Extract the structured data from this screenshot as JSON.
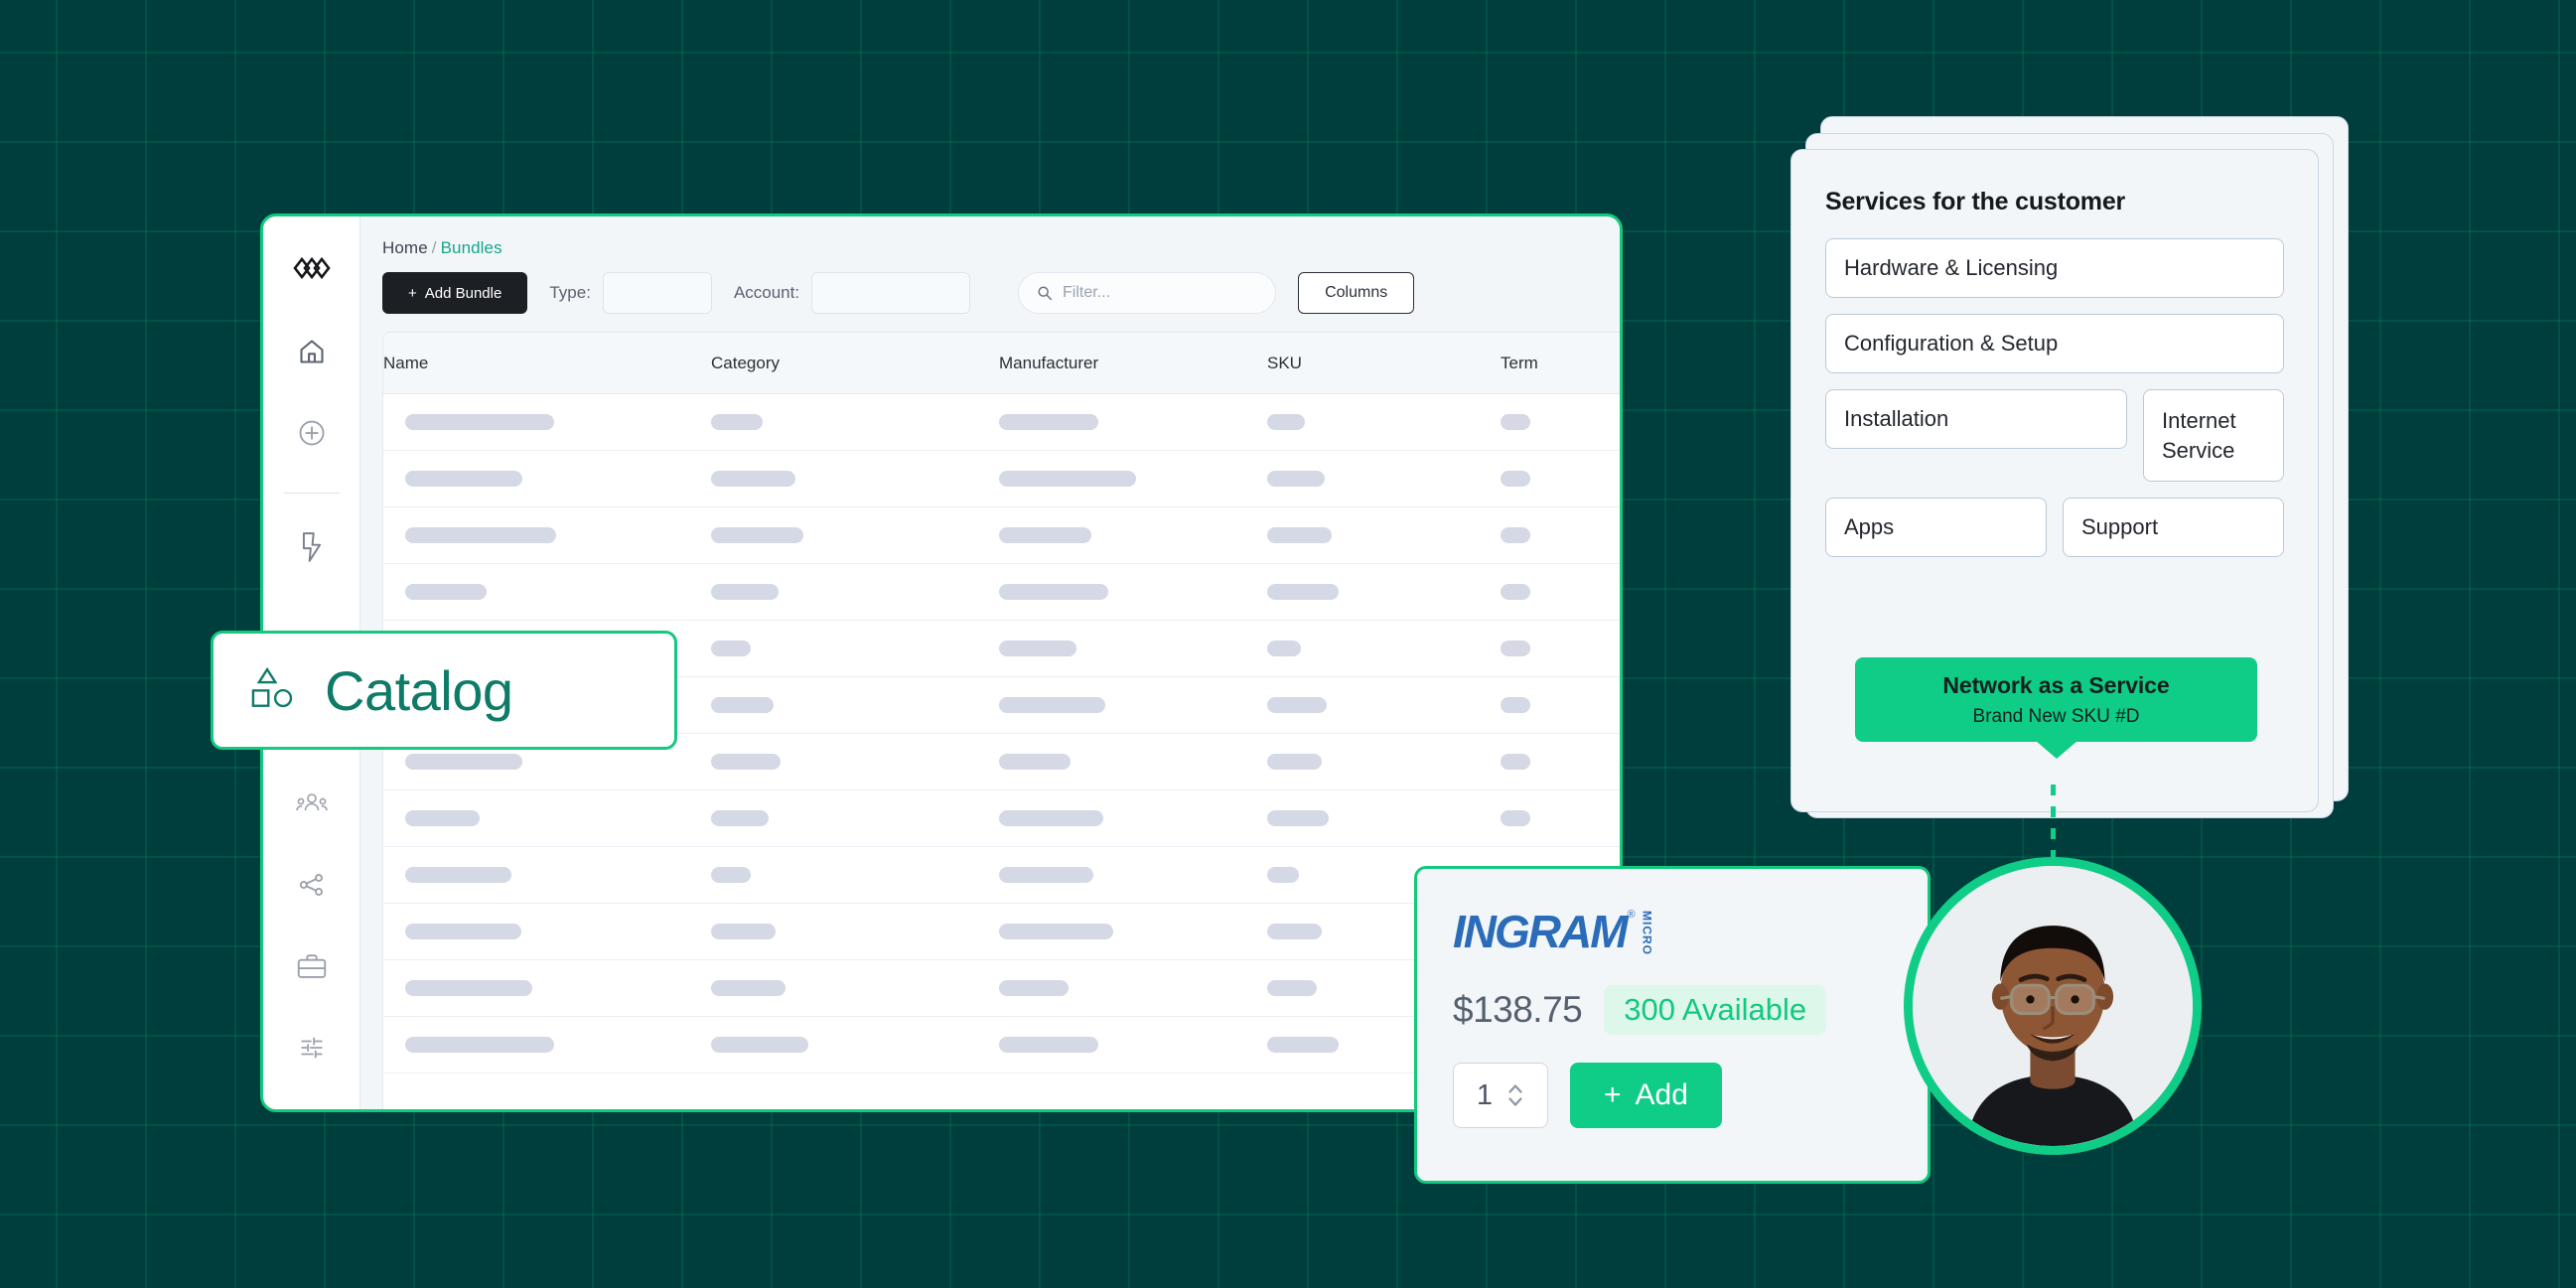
{
  "background": {
    "color": "#003d3d",
    "grid_color": "#00be78"
  },
  "accent": {
    "green": "#12c97e",
    "teal": "#0e7a68",
    "dark": "#1c1f24"
  },
  "app": {
    "breadcrumb": {
      "home": "Home",
      "separator": "/",
      "current": "Bundles"
    },
    "toolbar": {
      "add_bundle_label": "Add Bundle",
      "add_bundle_plus": "+",
      "type_label": "Type:",
      "type_value": "",
      "account_label": "Account:",
      "account_value": "",
      "filter_placeholder": "Filter...",
      "filter_value": "",
      "columns_label": "Columns"
    },
    "sidebar": {
      "items": [
        {
          "icon": "logo-diamonds-icon",
          "label": "Logo"
        },
        {
          "icon": "home-icon",
          "label": "Home"
        },
        {
          "icon": "plus-circle-icon",
          "label": "Add"
        },
        {
          "icon": "lightning-bolt-icon",
          "label": "Automations"
        },
        {
          "icon": "users-group-icon",
          "label": "Customers"
        },
        {
          "icon": "share-nodes-icon",
          "label": "Integrations"
        },
        {
          "icon": "briefcase-icon",
          "label": "Business"
        },
        {
          "icon": "sliders-icon",
          "label": "Settings"
        }
      ]
    },
    "table": {
      "columns": [
        "Name",
        "Category",
        "Manufacturer",
        "SKU",
        "Term"
      ],
      "rows": [
        {
          "name": 150,
          "category": 52,
          "manufacturer": 100,
          "sku": 38,
          "term": 30
        },
        {
          "name": 118,
          "category": 85,
          "manufacturer": 138,
          "sku": 58,
          "term": 30
        },
        {
          "name": 152,
          "category": 93,
          "manufacturer": 93,
          "sku": 65,
          "term": 30
        },
        {
          "name": 82,
          "category": 68,
          "manufacturer": 110,
          "sku": 72,
          "term": 30
        },
        {
          "name": 60,
          "category": 40,
          "manufacturer": 78,
          "sku": 34,
          "term": 30
        },
        {
          "name": 62,
          "category": 63,
          "manufacturer": 107,
          "sku": 60,
          "term": 30
        },
        {
          "name": 118,
          "category": 70,
          "manufacturer": 72,
          "sku": 55,
          "term": 30
        },
        {
          "name": 75,
          "category": 58,
          "manufacturer": 105,
          "sku": 62,
          "term": 30
        },
        {
          "name": 107,
          "category": 40,
          "manufacturer": 95,
          "sku": 32,
          "term": 0
        },
        {
          "name": 117,
          "category": 65,
          "manufacturer": 115,
          "sku": 55,
          "term": 0
        },
        {
          "name": 128,
          "category": 75,
          "manufacturer": 70,
          "sku": 50,
          "term": 0
        },
        {
          "name": 150,
          "category": 98,
          "manufacturer": 100,
          "sku": 72,
          "term": 0
        }
      ]
    }
  },
  "catalog_callout": {
    "label": "Catalog",
    "icon": "shapes-icon"
  },
  "services_panel": {
    "title": "Services for the customer",
    "chips_full": [
      "Hardware & Licensing",
      "Configuration & Setup"
    ],
    "chips_grid": [
      [
        "Installation",
        "Internet Service"
      ],
      [
        "Apps",
        "Support"
      ]
    ],
    "highlight_card": {
      "title": "Network as a Service",
      "subtitle": "Brand New SKU #D"
    }
  },
  "ingram_card": {
    "brand": "INGRAM",
    "brand_sub": "MICRO",
    "registered_mark": "®",
    "price": "$138.75",
    "stock": "300 Available",
    "quantity": "1",
    "add_plus": "+",
    "add_label": "Add"
  },
  "avatar": {
    "name": "customer-avatar"
  }
}
